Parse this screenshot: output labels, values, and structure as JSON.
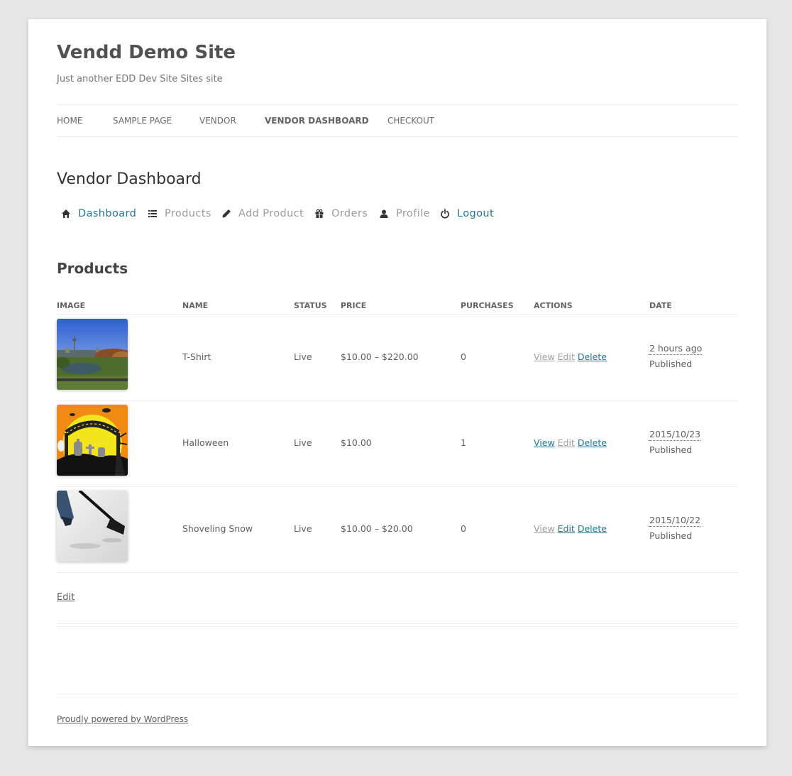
{
  "site": {
    "title": "Vendd Demo Site",
    "description": "Just another EDD Dev Site Sites site"
  },
  "main_nav": {
    "items": [
      {
        "label": "HOME"
      },
      {
        "label": "SAMPLE PAGE"
      },
      {
        "label": "VENDOR"
      },
      {
        "label": "VENDOR DASHBOARD",
        "current": true
      },
      {
        "label": "CHECKOUT"
      }
    ]
  },
  "page": {
    "title": "Vendor Dashboard"
  },
  "vendor_nav": {
    "items": [
      {
        "label": "Dashboard",
        "icon": "home-icon"
      },
      {
        "label": "Products",
        "icon": "list-icon"
      },
      {
        "label": "Add Product",
        "icon": "pencil-icon"
      },
      {
        "label": "Orders",
        "icon": "gift-icon"
      },
      {
        "label": "Profile",
        "icon": "user-icon"
      },
      {
        "label": "Logout",
        "icon": "power-icon"
      }
    ]
  },
  "products": {
    "title": "Products",
    "columns": [
      "IMAGE",
      "NAME",
      "STATUS",
      "PRICE",
      "PURCHASES",
      "ACTIONS",
      "DATE"
    ],
    "action_labels": {
      "view": "View",
      "edit": "Edit",
      "delete": "Delete"
    },
    "rows": [
      {
        "image": "park-skyline-image",
        "name": "T-Shirt",
        "status": "Live",
        "price": "$10.00 – $220.00",
        "purchases": "0",
        "date": "2 hours ago",
        "date_status": "Published",
        "view_enabled": false,
        "edit_enabled": false,
        "delete_enabled": true
      },
      {
        "image": "halloween-cemetery-image",
        "name": "Halloween",
        "status": "Live",
        "price": "$10.00",
        "purchases": "1",
        "date": "2015/10/23",
        "date_status": "Published",
        "view_enabled": true,
        "edit_enabled": false,
        "delete_enabled": true
      },
      {
        "image": "shoveling-snow-image",
        "name": "Shoveling Snow",
        "status": "Live",
        "price": "$10.00 – $20.00",
        "purchases": "0",
        "date": "2015/10/22",
        "date_status": "Published",
        "view_enabled": false,
        "edit_enabled": true,
        "delete_enabled": true
      }
    ]
  },
  "edit_link": "Edit",
  "footer": {
    "powered_by": "Proudly powered by WordPress"
  },
  "colors": {
    "link": "#21759b",
    "muted": "#9a9a9a",
    "background": "#e6e6e6"
  }
}
